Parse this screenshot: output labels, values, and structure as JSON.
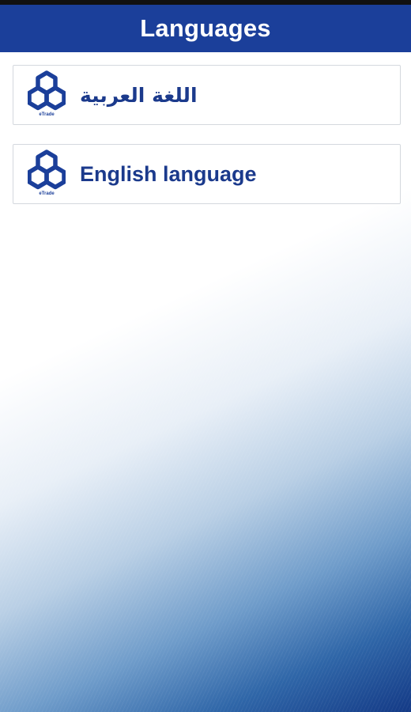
{
  "colors": {
    "header": "#1b3f9a",
    "accent_text": "#1b3a8c",
    "item_border": "#d4d8de",
    "gradient_dark": "#143a86"
  },
  "header": {
    "title": "Languages"
  },
  "languages": [
    {
      "label": "اللغة العربية",
      "logo_icon": "bank-logo-icon",
      "logo_text": "eTrade"
    },
    {
      "label": "English language",
      "logo_icon": "bank-logo-icon",
      "logo_text": "eTrade"
    }
  ]
}
